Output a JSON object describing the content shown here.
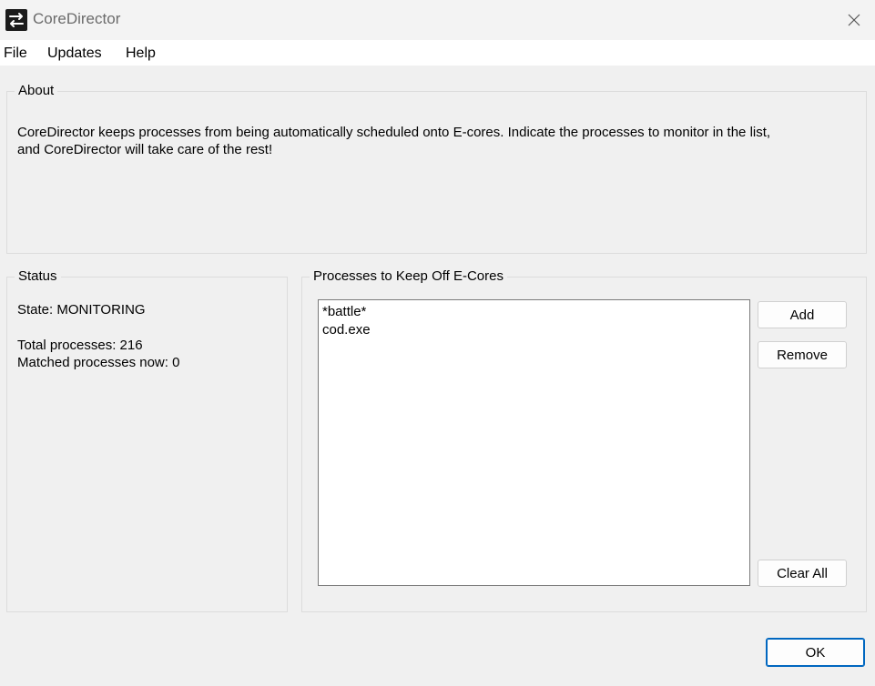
{
  "window": {
    "title": "CoreDirector",
    "app_icon": "arrows-swap-icon",
    "close_icon": "close-icon"
  },
  "menu": {
    "items": [
      "File",
      "Updates",
      "Help"
    ]
  },
  "about": {
    "label": "About",
    "text_line1": "CoreDirector keeps processes from being automatically scheduled onto E-cores. Indicate the processes to monitor in the list,",
    "text_line2": "and CoreDirector will take care of the rest!"
  },
  "status": {
    "label": "Status",
    "state": "State: MONITORING",
    "total": "Total processes: 216",
    "matched": "Matched processes now: 0"
  },
  "processes": {
    "label": "Processes to Keep Off E-Cores",
    "items": [
      "*battle*",
      "cod.exe"
    ],
    "add_label": "Add",
    "remove_label": "Remove",
    "clear_label": "Clear All"
  },
  "footer": {
    "ok_label": "OK"
  },
  "colors": {
    "accent": "#0067c0",
    "background": "#f0f0f0"
  }
}
